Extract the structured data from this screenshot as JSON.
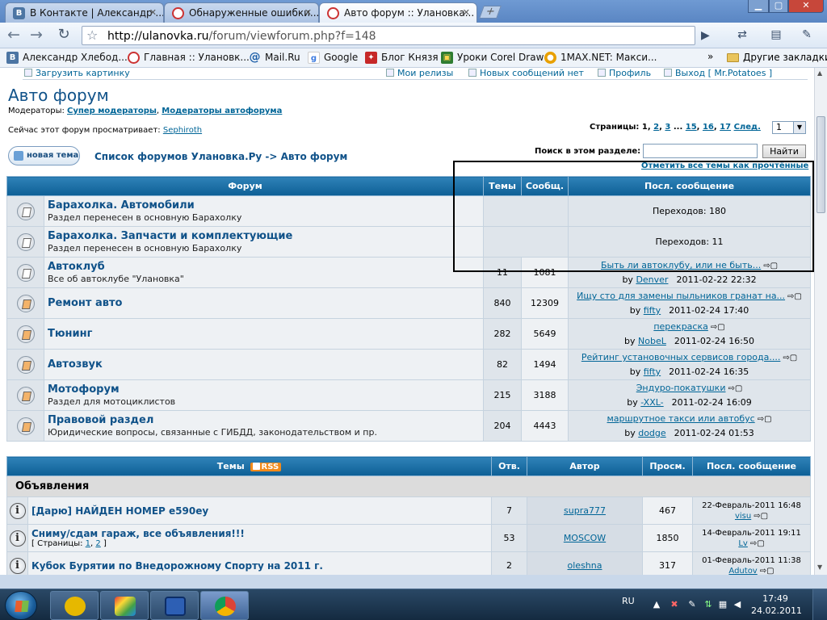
{
  "browser": {
    "tabs": [
      {
        "title": "В Контакте | Александр ...",
        "icon": "vk-icon"
      },
      {
        "title": "Обнаруженные ошибки...",
        "icon": "ulanovka-icon"
      },
      {
        "title": "Авто форум :: Улановка...",
        "icon": "ulanovka-icon",
        "active": true
      }
    ],
    "url_domain": "http://ulanovka.ru",
    "url_path": "/forum/viewforum.php?f=148",
    "bookmarks": [
      {
        "label": "Александр Хлебод...",
        "icon": "vk-icon",
        "color": "#4c75a3"
      },
      {
        "label": "Главная :: Улановк...",
        "icon": "ulanovka-icon",
        "color": "#c33333"
      },
      {
        "label": "Mail.Ru",
        "icon": "mailru-icon",
        "color": "#1d5fa8"
      },
      {
        "label": "Google",
        "icon": "google-icon",
        "color": "#3c7be0"
      },
      {
        "label": "Блог Князя",
        "icon": "blog-icon",
        "color": "#c62828"
      },
      {
        "label": "Уроки Corel Draw",
        "icon": "corel-icon",
        "color": "#2e7d32"
      },
      {
        "label": "1MAX.NET: Макси...",
        "icon": "1max-icon",
        "color": "#e8a000"
      }
    ],
    "bookmarks_more": "»",
    "other_bookmarks": "Другие закладки"
  },
  "page": {
    "top_links": {
      "upload": "Загрузить картинку",
      "my_releases": "Мои релизы",
      "no_new_posts": "Новых сообщений нет",
      "profile": "Профиль",
      "logout": "Выход [ Mr.Potatoes ]"
    },
    "forum_title": "Авто форум",
    "moderators_label": "Модераторы:",
    "moderators": [
      "Супер модераторы",
      "Модераторы автофорума"
    ],
    "viewing_label": "Сейчас этот форум просматривает:",
    "viewing_user": "Sephiroth",
    "pagination": {
      "label": "Страницы:",
      "current": "1",
      "pages": [
        "2",
        "3",
        "15",
        "16",
        "17"
      ],
      "ellipsis": "...",
      "next": "След.",
      "select_value": "1"
    },
    "new_topic_button": "новая тема",
    "breadcrumb": "Список форумов Улановка.Ру -> Авто форум",
    "search_label": "Поиск в этом разделе:",
    "search_value": "",
    "search_button": "Найти",
    "mark_read": "Отметить все темы как прочтённые"
  },
  "forums_table": {
    "headers": {
      "forum": "Форум",
      "topics": "Темы",
      "posts": "Сообщ.",
      "last": "Посл. сообщение"
    },
    "rows": [
      {
        "name": "Барахолка. Автомобили",
        "desc": "Раздел перенесен в основную Барахолку",
        "topics": "",
        "posts": "",
        "redirect": "Переходов: 180"
      },
      {
        "name": "Барахолка. Запчасти и комплектующие",
        "desc": "Раздел перенесен в основную Барахолку",
        "topics": "",
        "posts": "",
        "redirect": "Переходов: 11"
      },
      {
        "name": "Автоклуб",
        "desc": "Все об автоклубе \"Улановка\"",
        "topics": "11",
        "posts": "1081",
        "last_title": "Быть ли автоклубу, или не быть...",
        "last_by": "by",
        "last_user": "Denver",
        "last_date": "2011-02-22 22:32"
      },
      {
        "name": "Ремонт авто",
        "desc": "",
        "topics": "840",
        "posts": "12309",
        "last_title": "Ищу сто для замены пыльников гранат на...",
        "last_by": "by",
        "last_user": "fifty",
        "last_date": "2011-02-24 17:40"
      },
      {
        "name": "Тюнинг",
        "desc": "",
        "topics": "282",
        "posts": "5649",
        "last_title": "перекраска",
        "last_by": "by",
        "last_user": "NobeL",
        "last_date": "2011-02-24 16:50"
      },
      {
        "name": "Автозвук",
        "desc": "",
        "topics": "82",
        "posts": "1494",
        "last_title": "Рейтинг установочных сервисов города....",
        "last_by": "by",
        "last_user": "fifty",
        "last_date": "2011-02-24 16:35"
      },
      {
        "name": "Мотофорум",
        "desc": "Раздел для мотоциклистов",
        "topics": "215",
        "posts": "3188",
        "last_title": "Эндуро-покатушки",
        "last_by": "by",
        "last_user": "-XXL-",
        "last_date": "2011-02-24 16:09"
      },
      {
        "name": "Правовой раздел",
        "desc": "Юридические вопросы, связанные с ГИБДД, законодательством и пр.",
        "topics": "204",
        "posts": "4443",
        "last_title": "маршрутное такси или автобус",
        "last_by": "by",
        "last_user": "dodge",
        "last_date": "2011-02-24 01:53"
      }
    ]
  },
  "topics_table": {
    "headers": {
      "topics": "Темы",
      "rss": "RSS",
      "replies": "Отв.",
      "author": "Автор",
      "views": "Просм.",
      "last": "Посл. сообщение"
    },
    "section": "Объявления",
    "rows": [
      {
        "title": "[Дарю] НАЙДЕН НОМЕР е590еу",
        "pages_label": "",
        "pages": [],
        "replies": "7",
        "author": "supra777",
        "views": "467",
        "last_date": "22-Февраль-2011 16:48",
        "last_user": "visu"
      },
      {
        "title": "Сниму/сдам гараж, все объявления!!!",
        "pages_label": "[ Страницы:",
        "pages": [
          "1",
          "2"
        ],
        "pages_close": "]",
        "replies": "53",
        "author": "MOSCOW",
        "views": "1850",
        "last_date": "14-Февраль-2011 19:11",
        "last_user": "Lv"
      },
      {
        "title": "Кубок Бурятии по Внедорожному Спорту на 2011 г.",
        "pages_label": "",
        "pages": [],
        "replies": "2",
        "author": "oleshna",
        "views": "317",
        "last_date": "01-Февраль-2011 11:38",
        "last_user": "Adutov"
      }
    ]
  },
  "taskbar": {
    "lang": "RU",
    "time": "17:49",
    "date": "24.02.2011",
    "apps": [
      {
        "name": "aimp-icon",
        "color": "#e6b800"
      },
      {
        "name": "studio-icon",
        "color": "#c0392b"
      },
      {
        "name": "floppy-icon",
        "color": "#2d5fb4"
      },
      {
        "name": "chrome-icon",
        "color": "#4caf50"
      }
    ]
  }
}
